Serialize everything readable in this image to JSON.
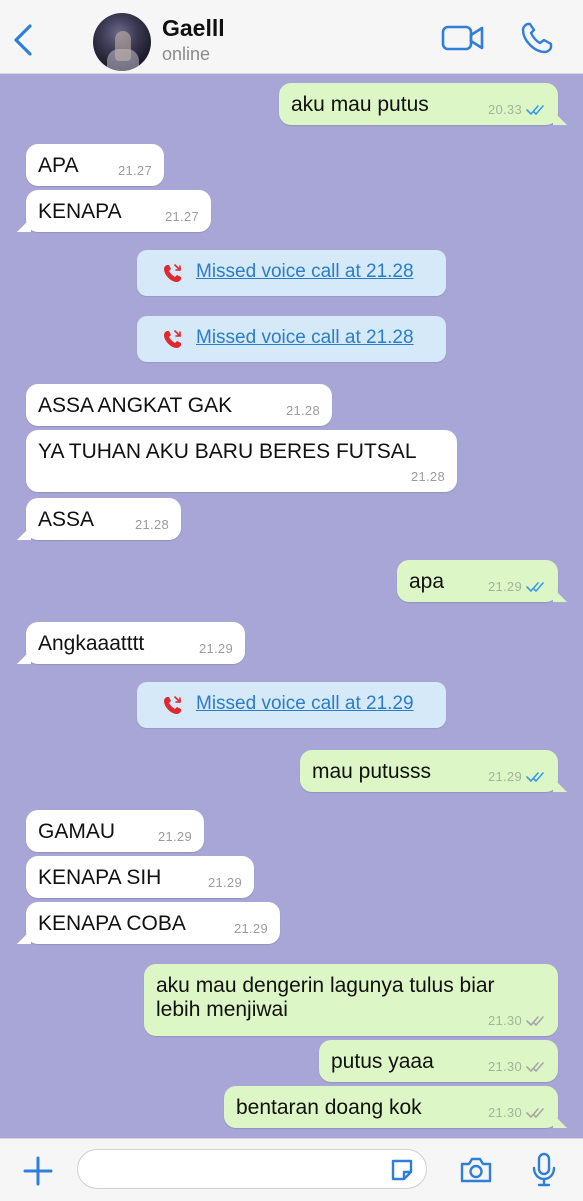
{
  "header": {
    "contact_name": "Gaelll",
    "status": "online"
  },
  "colors": {
    "accent": "#2f7fd8",
    "chat_background": "#a8a6d6",
    "outgoing_bubble": "#dcf7c5",
    "incoming_bubble": "#ffffff",
    "missed_call_bubble": "#d6e9f8",
    "missed_call_icon": "#e0282e",
    "read_ticks": "#3a9be8",
    "delivered_ticks": "#a7a7a7"
  },
  "icons": {
    "back": "chevron-left-icon",
    "video": "video-camera-icon",
    "phone": "phone-icon",
    "add": "plus-icon",
    "sticker": "sticker-icon",
    "camera": "camera-icon",
    "mic": "microphone-icon",
    "missed_call": "missed-call-icon"
  },
  "messages": [
    {
      "dir": "out",
      "text": "aku mau putus",
      "time": "20.33",
      "status": "read"
    },
    {
      "dir": "in",
      "text": "APA",
      "time": "21.27"
    },
    {
      "dir": "in",
      "text": "KENAPA",
      "time": "21.27"
    },
    {
      "dir": "system",
      "text": "Missed voice call at 21.28"
    },
    {
      "dir": "system",
      "text": "Missed voice call at 21.28"
    },
    {
      "dir": "in",
      "text": "ASSA ANGKAT GAK",
      "time": "21.28"
    },
    {
      "dir": "in",
      "text": "YA TUHAN AKU BARU BERES FUTSAL",
      "time": "21.28"
    },
    {
      "dir": "in",
      "text": "ASSA",
      "time": "21.28"
    },
    {
      "dir": "out",
      "text": "apa",
      "time": "21.29",
      "status": "read"
    },
    {
      "dir": "in",
      "text": "Angkaaatttt",
      "time": "21.29"
    },
    {
      "dir": "system",
      "text": "Missed voice call at 21.29"
    },
    {
      "dir": "out",
      "text": "mau putusss",
      "time": "21.29",
      "status": "read"
    },
    {
      "dir": "in",
      "text": "GAMAU",
      "time": "21.29"
    },
    {
      "dir": "in",
      "text": "KENAPA SIH",
      "time": "21.29"
    },
    {
      "dir": "in",
      "text": "KENAPA COBA",
      "time": "21.29"
    },
    {
      "dir": "out",
      "text_line1": "aku mau dengerin lagunya tulus biar",
      "text_line2": "lebih menjiwai",
      "time": "21.30",
      "status": "delivered"
    },
    {
      "dir": "out",
      "text": "putus yaaa",
      "time": "21.30",
      "status": "delivered"
    },
    {
      "dir": "out",
      "text": "bentaran doang kok",
      "time": "21.30",
      "status": "delivered"
    }
  ],
  "composer": {
    "value": ""
  }
}
